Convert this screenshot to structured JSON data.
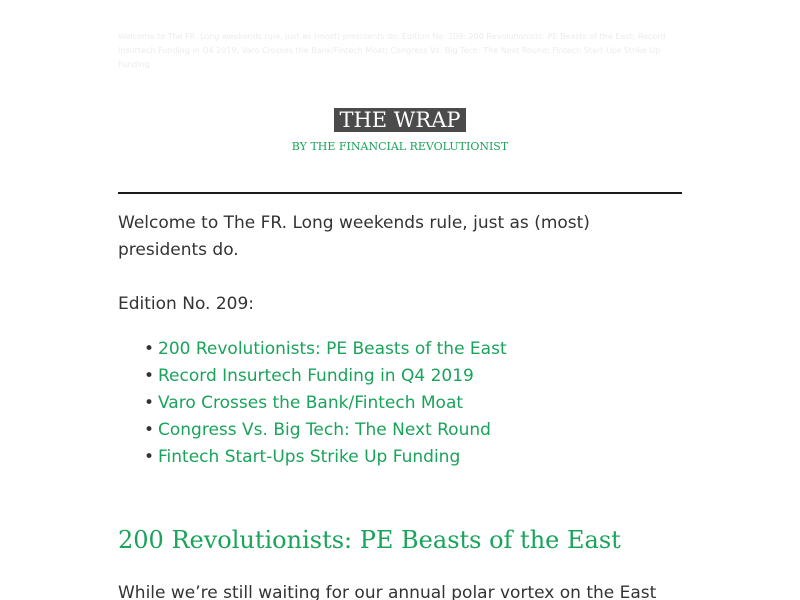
{
  "preheader": "Welcome to The FR. Long weekends rule, just as (most) presidents do. Edition No. 209: 200 Revolutionists: PE Beasts of the East; Record Insurtech Funding in Q4 2019; Varo Crosses the Bank/Fintech Moat; Congress Vs. Big Tech: The Next Round; Fintech Start-Ups Strike Up Funding",
  "masthead": {
    "title": "THE WRAP",
    "byline": "BY THE FINANCIAL REVOLUTIONIST"
  },
  "intro": "Welcome to The FR. Long weekends rule, just as (most) presidents do.",
  "edition": "Edition No. 209:",
  "toc": [
    "200 Revolutionists: PE Beasts of the East",
    "Record Insurtech Funding in Q4 2019",
    "Varo Crosses the Bank/Fintech Moat",
    "Congress Vs. Big Tech: The Next Round",
    "Fintech Start-Ups Strike Up Funding"
  ],
  "section": {
    "heading": "200 Revolutionists: PE Beasts of the East",
    "lead": "While we’re still waiting for our annual polar vortex on the East"
  },
  "colors": {
    "accent": "#1aa35a",
    "text": "#333333",
    "masthead_bg": "#4b4b4b"
  }
}
